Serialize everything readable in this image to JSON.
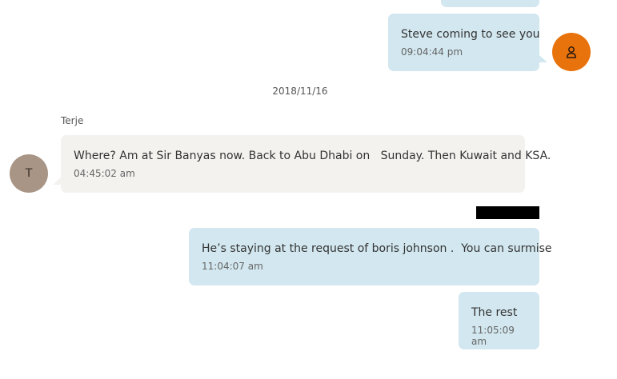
{
  "messages": [
    {
      "id": "prev-out",
      "direction": "outgoing",
      "text": "",
      "time": ""
    },
    {
      "id": "m1",
      "direction": "outgoing",
      "text": "Steve coming to see you",
      "time": "09:04:44 pm"
    },
    {
      "id": "m2",
      "direction": "incoming",
      "sender": "Terje",
      "avatar_initial": "T",
      "text": "Where? Am at Sir Banyas now. Back to Abu Dhabi on   Sunday. Then Kuwait and KSA.",
      "time": "04:45:02 am"
    },
    {
      "id": "m3",
      "direction": "outgoing",
      "text": "He’s staying at the request of boris johnson .  You can surmise",
      "time": "11:04:07 am"
    },
    {
      "id": "m4",
      "direction": "outgoing",
      "text": "The rest",
      "time": "11:05:09 am"
    }
  ],
  "date_separator": "2018/11/16",
  "sender_label": "Terje",
  "avatar_initial": "T",
  "colors": {
    "outgoing_bubble": "#d2e7ef",
    "incoming_bubble": "#f3f2ef",
    "my_avatar": "#e8720c",
    "other_avatar": "#a89586",
    "redaction": "#000000"
  },
  "icons": {
    "my_avatar": "person-icon"
  }
}
